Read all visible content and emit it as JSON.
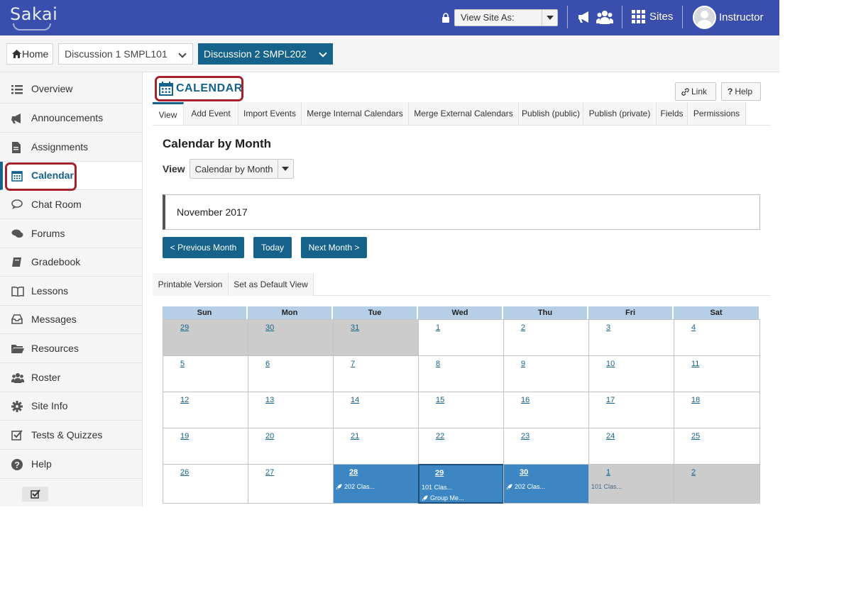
{
  "topbar": {
    "logo": "Sakai",
    "view_site_as": "View Site As:",
    "sites_label": "Sites",
    "user_label": "Instructor"
  },
  "sitenav": {
    "home": "Home",
    "sites": [
      {
        "label": "Discussion 1 SMPL101"
      },
      {
        "label": "Discussion 2 SMPL202"
      }
    ]
  },
  "tools": [
    {
      "label": "Overview",
      "icon": "list-icon"
    },
    {
      "label": "Announcements",
      "icon": "megaphone-icon"
    },
    {
      "label": "Assignments",
      "icon": "document-icon"
    },
    {
      "label": "Calendar",
      "icon": "calendar-icon"
    },
    {
      "label": "Chat Room",
      "icon": "chat-icon"
    },
    {
      "label": "Forums",
      "icon": "comments-icon"
    },
    {
      "label": "Gradebook",
      "icon": "book-icon"
    },
    {
      "label": "Lessons",
      "icon": "open-book-icon"
    },
    {
      "label": "Messages",
      "icon": "inbox-icon"
    },
    {
      "label": "Resources",
      "icon": "folder-icon"
    },
    {
      "label": "Roster",
      "icon": "users-icon"
    },
    {
      "label": "Site Info",
      "icon": "gear-icon"
    },
    {
      "label": "Tests & Quizzes",
      "icon": "checkbox-icon"
    },
    {
      "label": "Help",
      "icon": "question-icon"
    }
  ],
  "main": {
    "title": "CALENDAR",
    "link_btn": "Link",
    "help_btn": "Help",
    "subnav": [
      "View",
      "Add Event",
      "Import Events",
      "Merge Internal Calendars",
      "Merge External Calendars",
      "Publish (public)",
      "Publish (private)",
      "Fields",
      "Permissions"
    ],
    "heading": "Calendar by Month",
    "view_label": "View",
    "view_value": "Calendar by Month",
    "month": "November 2017",
    "prev_btn": "< Previous Month",
    "today_btn": "Today",
    "next_btn": "Next Month >",
    "printable": "Printable Version",
    "set_default": "Set as Default View"
  },
  "calendar": {
    "days": [
      "Sun",
      "Mon",
      "Tue",
      "Wed",
      "Thu",
      "Fri",
      "Sat"
    ],
    "weeks": [
      [
        {
          "d": "29",
          "s": "grey"
        },
        {
          "d": "30",
          "s": "grey"
        },
        {
          "d": "31",
          "s": "grey"
        },
        {
          "d": "1"
        },
        {
          "d": "2"
        },
        {
          "d": "3"
        },
        {
          "d": "4"
        }
      ],
      [
        {
          "d": "5"
        },
        {
          "d": "6"
        },
        {
          "d": "7"
        },
        {
          "d": "8"
        },
        {
          "d": "9"
        },
        {
          "d": "10"
        },
        {
          "d": "11"
        }
      ],
      [
        {
          "d": "12"
        },
        {
          "d": "13"
        },
        {
          "d": "14"
        },
        {
          "d": "15"
        },
        {
          "d": "16"
        },
        {
          "d": "17"
        },
        {
          "d": "18"
        }
      ],
      [
        {
          "d": "19"
        },
        {
          "d": "20"
        },
        {
          "d": "21"
        },
        {
          "d": "22"
        },
        {
          "d": "23"
        },
        {
          "d": "24"
        },
        {
          "d": "25"
        }
      ],
      [
        {
          "d": "26"
        },
        {
          "d": "27"
        },
        {
          "d": "28",
          "s": "busy",
          "events": [
            {
              "t": "202 Clas...",
              "icon": true
            }
          ]
        },
        {
          "d": "29",
          "s": "busy",
          "sel": true,
          "events": [
            {
              "t": "101 Clas...",
              "icon": false
            },
            {
              "t": "Group Me...",
              "icon": true
            }
          ]
        },
        {
          "d": "30",
          "s": "busy",
          "events": [
            {
              "t": "202 Clas...",
              "icon": true
            }
          ]
        },
        {
          "d": "1",
          "s": "grey",
          "events": [
            {
              "t": "101 Clas...",
              "icon": false
            }
          ]
        },
        {
          "d": "2",
          "s": "grey"
        }
      ]
    ]
  }
}
